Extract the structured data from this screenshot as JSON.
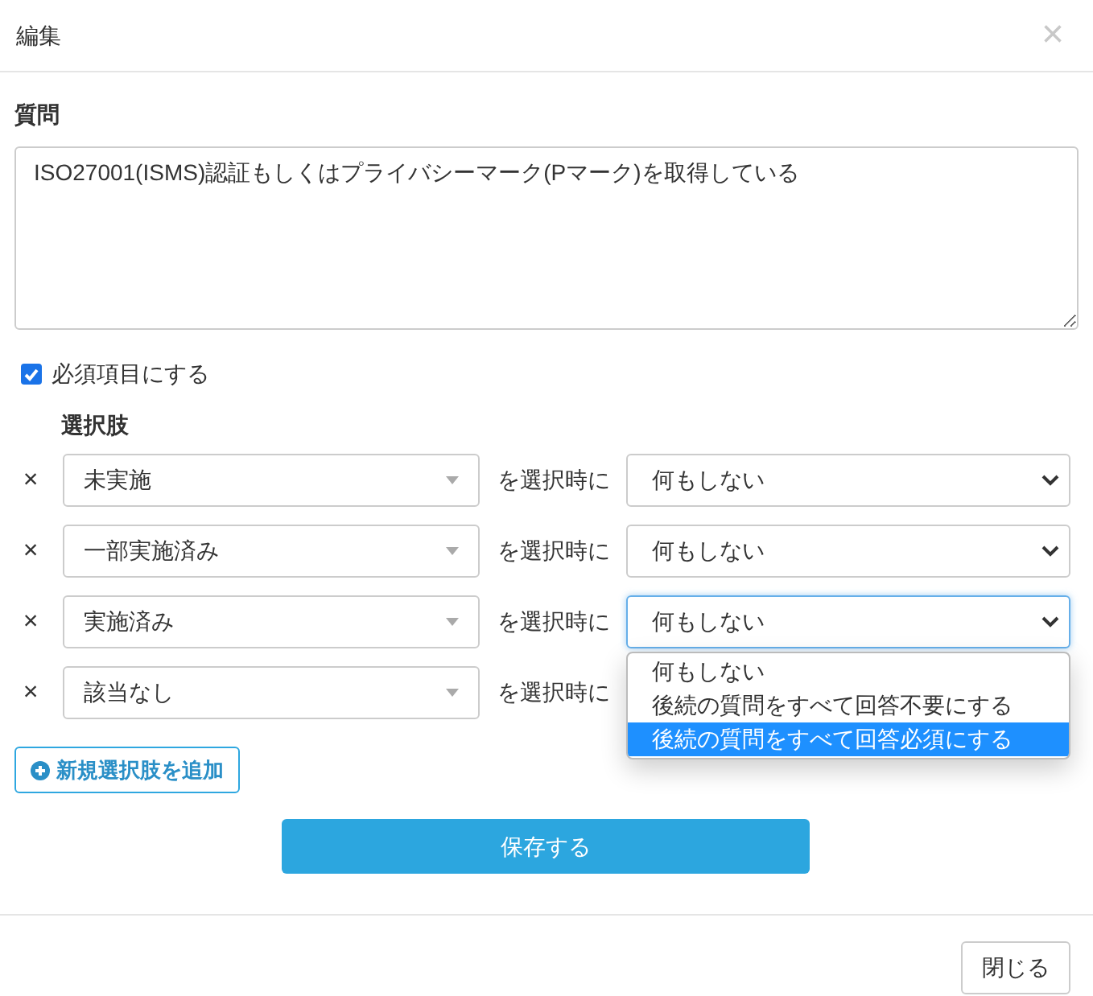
{
  "dialog": {
    "title": "編集",
    "close_icon": "×"
  },
  "question": {
    "label": "質問",
    "value": "ISO27001(ISMS)認証もしくはプライバシーマーク(Pマーク)を取得している"
  },
  "required": {
    "label": "必須項目にする",
    "checked": true
  },
  "choices": {
    "label": "選択肢",
    "rows": [
      {
        "remove": "×",
        "value": "未実施",
        "connector": "を選択時に",
        "action": "何もしない"
      },
      {
        "remove": "×",
        "value": "一部実施済み",
        "connector": "を選択時に",
        "action": "何もしない"
      },
      {
        "remove": "×",
        "value": "実施済み",
        "connector": "を選択時に",
        "action": "何もしない",
        "expanded": true,
        "menu": [
          {
            "label": "何もしない",
            "selected": false
          },
          {
            "label": "後続の質問をすべて回答不要にする",
            "selected": false
          },
          {
            "label": "後続の質問をすべて回答必須にする",
            "selected": true
          }
        ]
      },
      {
        "remove": "×",
        "value": "該当なし",
        "connector": "を選択時に"
      }
    ]
  },
  "add_button": "新規選択肢を追加",
  "save_button": "保存する",
  "footer": {
    "close_button": "閉じる"
  }
}
